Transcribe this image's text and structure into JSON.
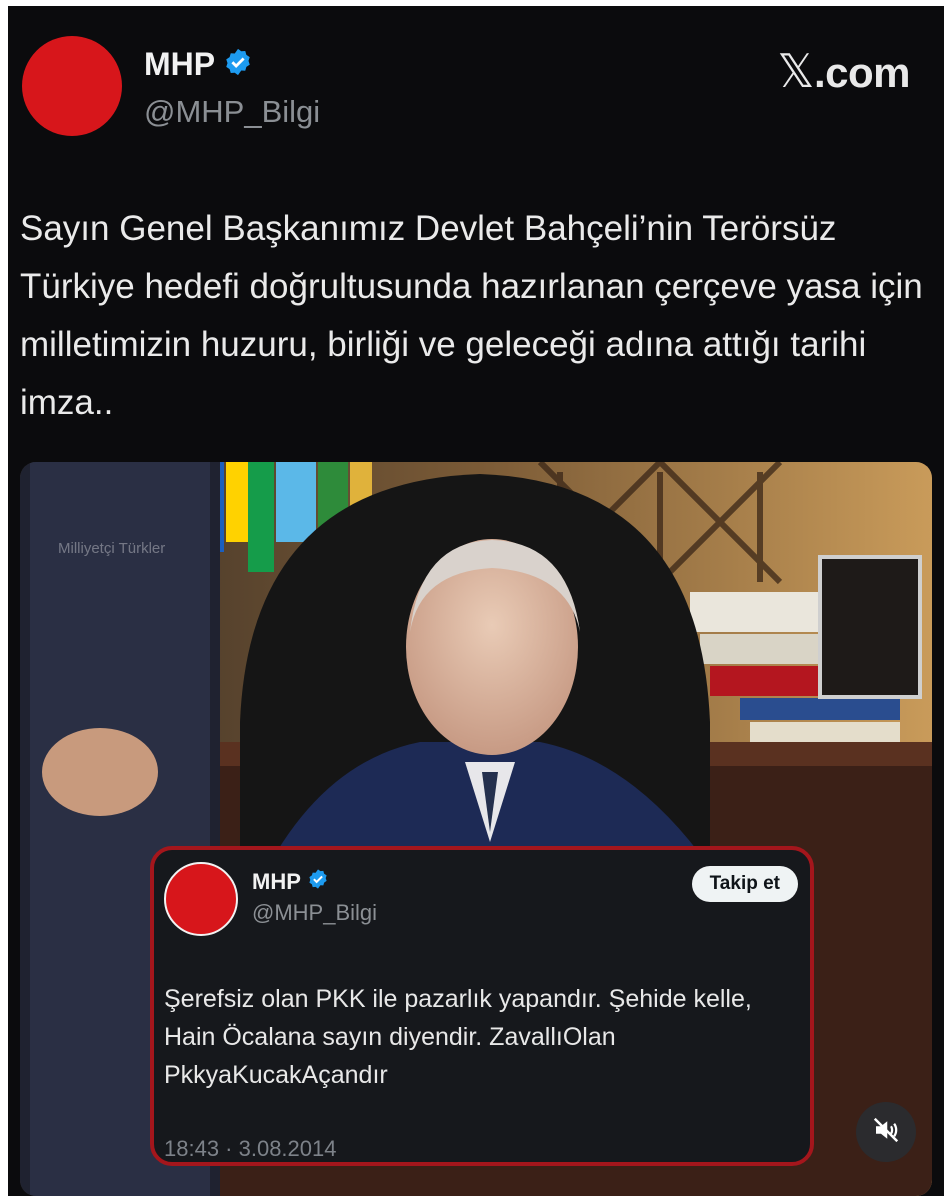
{
  "post": {
    "author_name": "MHP",
    "author_handle": "@MHP_Bilgi",
    "source_label": ".com",
    "source_logo": "x-logo",
    "text": "Sayın Genel Başkanımız Devlet Bahçeli’nin Terörsüz Türkiye hedefi doğrultusunda hazırlanan çerçeve yasa için milletimizin huzuru, birliği ve geleceği adına attığı tarihi imza..",
    "photo_watermark": "Milliyetçi Türkler"
  },
  "embedded_tweet": {
    "author_name": "MHP",
    "author_handle": "@MHP_Bilgi",
    "follow_label": "Takip et",
    "text": "Şerefsiz olan PKK ile pazarlık yapandır. Şehide kelle, Hain Öcalana sayın diyendir. ZavallıOlan PkkyaKucakAçandır",
    "timestamp": "18:43 · 3.08.2014",
    "frame_color": "#a4161c"
  },
  "colors": {
    "background": "#0b0b0d",
    "brand_red": "#d7161b",
    "verified_blue": "#1d9bf0"
  },
  "icons": [
    "mhp-logo-icon",
    "verified-badge-icon",
    "x-logo-icon",
    "mute-icon"
  ]
}
